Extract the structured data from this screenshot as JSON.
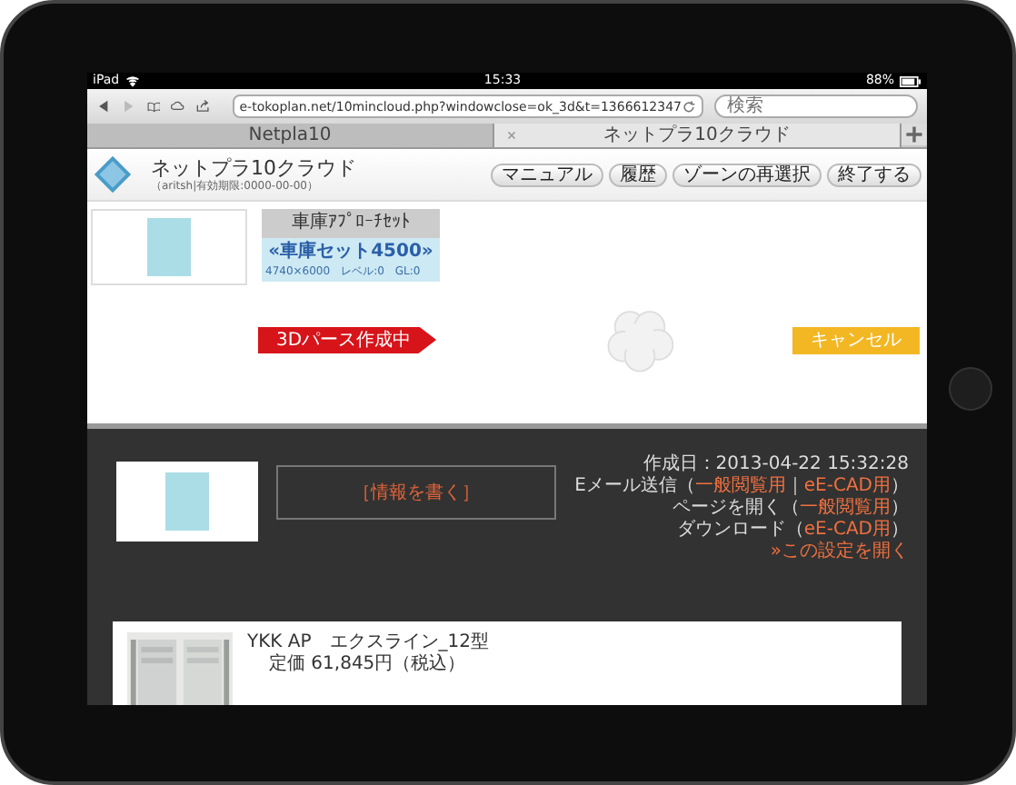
{
  "status_bar": {
    "device": "iPad",
    "time": "15:33",
    "battery": "88%"
  },
  "browser": {
    "url": "e-tokoplan.net/10mincloud.php?windowclose=ok_3d&t=1366612347",
    "search": {
      "placeholder": "検索"
    },
    "tabs": [
      {
        "label": "Netpla10",
        "selected": false,
        "closable": false
      },
      {
        "label": "ネットプラ10クラウド",
        "selected": true,
        "closable": true
      }
    ]
  },
  "header": {
    "title": "ネットプラ10クラウド",
    "subtitle": "（aritsh|有効期限:0000-00-00）",
    "buttons": [
      "マニュアル",
      "履歴",
      "ゾーンの再選択",
      "終了する"
    ]
  },
  "set_card": {
    "category": "車庫ｱﾌﾟﾛｰﾁｾｯﾄ",
    "name": "«車庫セット4500»",
    "details": "4740×6000　レベル:0　GL:0"
  },
  "status_badge": "3Dパース作成中",
  "cancel_button": "キャンセル",
  "info": {
    "write_button": "［情報を書く］",
    "lines": [
      [
        {
          "text": "作成日：2013-04-22 15:32:28",
          "link": false
        }
      ],
      [
        {
          "text": "Eメール送信（",
          "link": false
        },
        {
          "text": "一般閲覧用",
          "link": true
        },
        {
          "text": "｜",
          "link": false
        },
        {
          "text": "eE-CAD用",
          "link": true
        },
        {
          "text": "）",
          "link": false
        }
      ],
      [
        {
          "text": "ページを開く（",
          "link": false
        },
        {
          "text": "一般閲覧用",
          "link": true
        },
        {
          "text": "）",
          "link": false
        }
      ],
      [
        {
          "text": "ダウンロード（",
          "link": false
        },
        {
          "text": "eE-CAD用",
          "link": true
        },
        {
          "text": "）",
          "link": false
        }
      ],
      [
        {
          "text": "»この設定を開く",
          "link": true
        }
      ]
    ]
  },
  "product": {
    "name": "YKK AP　エクスライン_12型",
    "price": "定価 61,845円（税込）"
  }
}
